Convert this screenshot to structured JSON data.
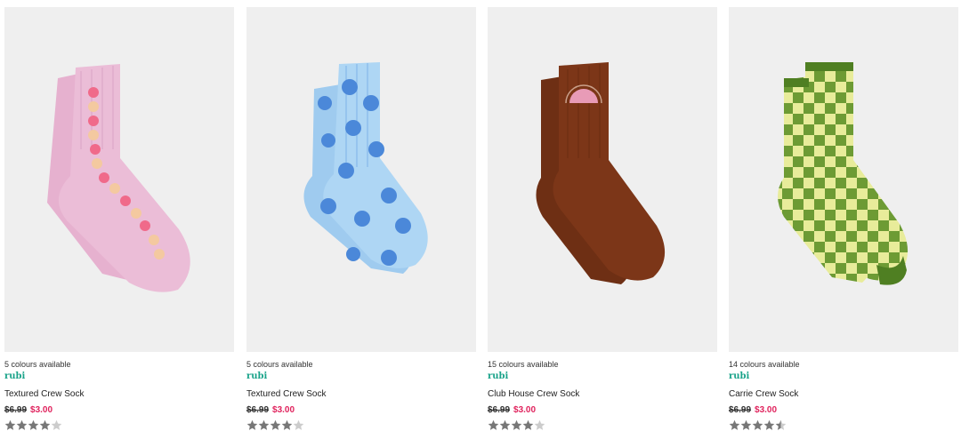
{
  "products": [
    {
      "colours": "5 colours available",
      "brand": "rubi",
      "name": "Textured Crew Sock",
      "was_price": "$6.99",
      "now_price": "$3.00",
      "rating": 4,
      "colors": {
        "main": "#e9b8d4",
        "accent1": "#f06a8a",
        "accent2": "#f4c9a0"
      }
    },
    {
      "colours": "5 colours available",
      "brand": "rubi",
      "name": "Textured Crew Sock",
      "was_price": "$6.99",
      "now_price": "$3.00",
      "rating": 4,
      "colors": {
        "main": "#a9d3f2",
        "accent1": "#4b88d9",
        "accent2": "#7fb3e8"
      }
    },
    {
      "colours": "15 colours available",
      "brand": "rubi",
      "name": "Club House Crew Sock",
      "was_price": "$6.99",
      "now_price": "$3.00",
      "rating": 4,
      "colors": {
        "main": "#7a3517",
        "accent1": "#e89bb7",
        "accent2": "#5a250f"
      }
    },
    {
      "colours": "14 colours available",
      "brand": "rubi",
      "name": "Carrie Crew Sock",
      "was_price": "$6.99",
      "now_price": "$3.00",
      "rating": 4.5,
      "colors": {
        "main": "#6d9b34",
        "accent1": "#e8ec9a",
        "accent2": "#4f7f22"
      }
    }
  ],
  "star_colors": {
    "filled": "#777777",
    "empty": "#cccccc"
  }
}
